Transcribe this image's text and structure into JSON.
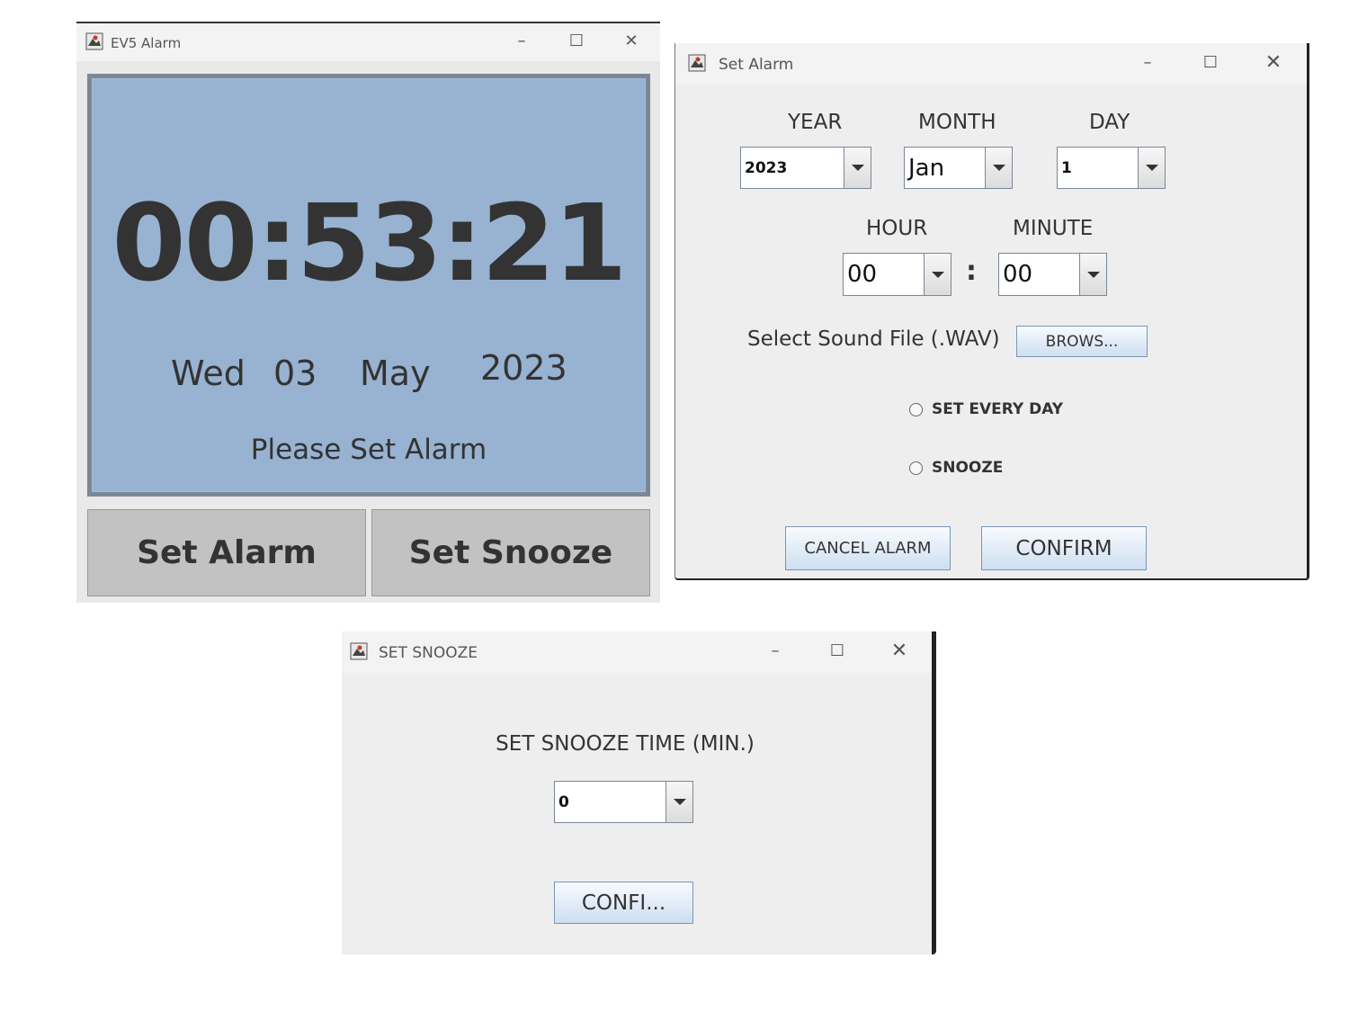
{
  "main_window": {
    "title": "EV5 Alarm",
    "controls": {
      "minimize": "–",
      "maximize": "☐",
      "close": "✕"
    },
    "clock": {
      "time": "00:53:21",
      "weekday": "Wed",
      "day": "03",
      "month": "May",
      "year": "2023",
      "status": "Please Set Alarm"
    },
    "buttons": {
      "set_alarm": "Set Alarm",
      "set_snooze": "Set Snooze"
    },
    "colors": {
      "panel": "#98b2d1",
      "panel_border": "#7a8797",
      "button": "#c2c2c2"
    }
  },
  "alarm_window": {
    "title": "Set Alarm",
    "controls": {
      "minimize": "–",
      "maximize": "☐",
      "close": "✕"
    },
    "labels": {
      "year": "YEAR",
      "month": "MONTH",
      "day": "DAY",
      "hour": "HOUR",
      "minute": "MINUTE",
      "time_separator": ":"
    },
    "selects": {
      "year": "2023",
      "month": "Jan",
      "day": "1",
      "hour": "00",
      "minute": "00"
    },
    "sound": {
      "label": "Select Sound File (.WAV)",
      "browse_button": "BROWS..."
    },
    "options": {
      "every_day": "SET EVERY DAY",
      "snooze": "SNOOZE"
    },
    "buttons": {
      "cancel": "CANCEL ALARM",
      "confirm": "CONFIRM"
    }
  },
  "snooze_window": {
    "title": "SET SNOOZE",
    "controls": {
      "minimize": "–",
      "maximize": "☐",
      "close": "✕"
    },
    "label": "SET SNOOZE TIME (MIN.)",
    "select_value": "0",
    "confirm_button": "CONFI..."
  }
}
